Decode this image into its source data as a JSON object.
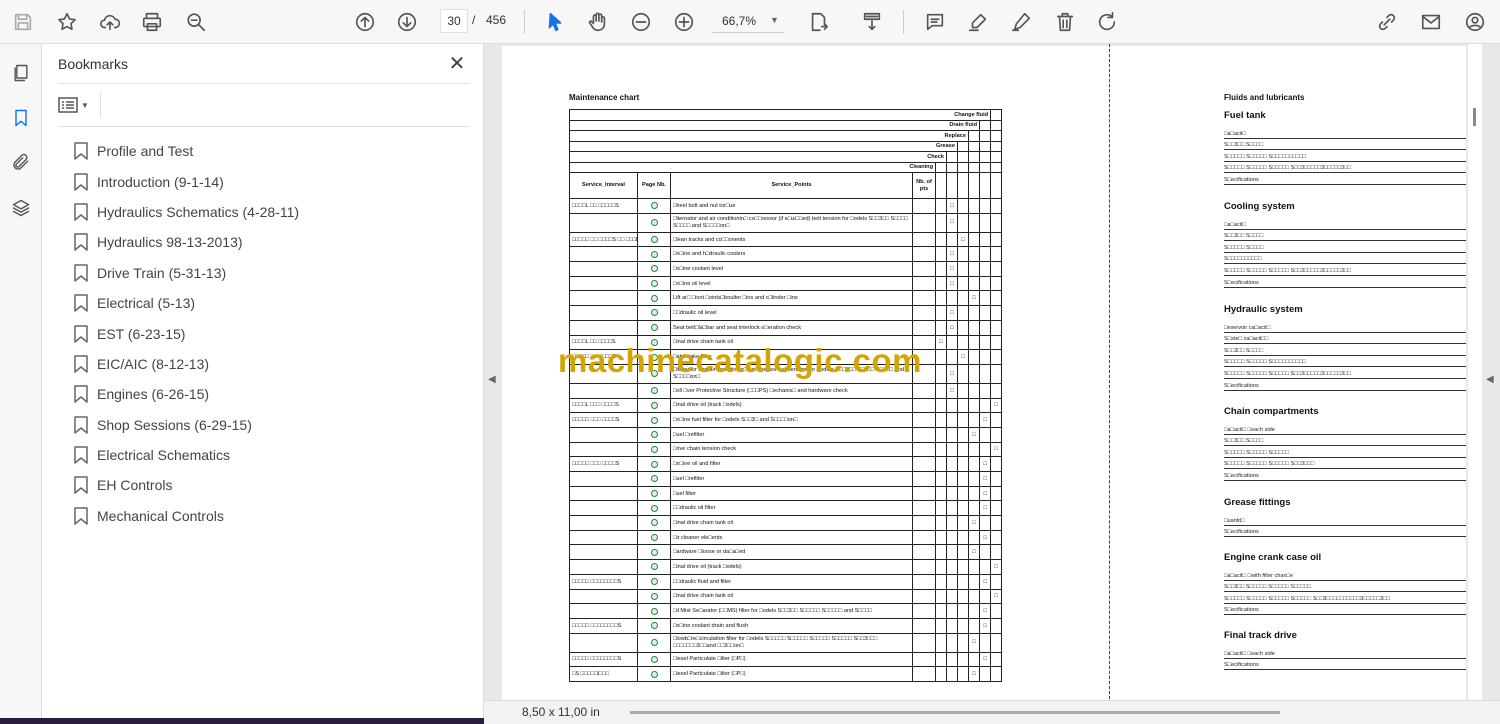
{
  "toolbar": {
    "current_page": "30",
    "page_separator": "/",
    "total_pages": "456",
    "zoom": "66,7%"
  },
  "bookmarks_panel": {
    "title": "Bookmarks",
    "items": [
      "Profile and Test",
      "Introduction (9-1-14)",
      "Hydraulics Schematics (4-28-11)",
      "Hydraulics 98-13-2013)",
      "Drive Train (5-31-13)",
      "Electrical (5-13)",
      "EST (6-23-15)",
      "EIC/AIC (8-12-13)",
      "Engines (6-26-15)",
      "Shop Sessions (6-29-15)",
      "Electrical Schematics",
      "EH Controls",
      "Mechanical Controls"
    ]
  },
  "status": {
    "page_size": "8,50 x 11,00 in"
  },
  "watermark": "machinecatalogic.com",
  "maintenance_chart": {
    "title": "Maintenance chart",
    "header_rows": [
      "Change fluid",
      "Drain fluid",
      "Replace",
      "Grease",
      "Check",
      "Cleaning"
    ],
    "columns": [
      "Service_Interval",
      "Page Nb.",
      "Service_Points",
      "Nb. of pts"
    ],
    "rows": [
      {
        "interval": "□□□□L □□ □□□□□S",
        "point": "□heel bolt and nut tor□ue",
        "tall": false
      },
      {
        "interval": "",
        "point": "□lternator and air conditionin□ co□□ressor (if e□ui□□ed) belt tension for □odels S□□3□□ S□□□□ S□□□□ and S□□□□on□",
        "tall": true
      },
      {
        "interval": "□□□□□ □□ □□□□S □□ □□□L□",
        "point": "□lean tracks and co□□onents",
        "tall": false
      },
      {
        "interval": "",
        "point": "□n□ine and h□draulic coolers",
        "tall": false
      },
      {
        "interval": "",
        "point": "□n□ine coolant level",
        "tall": false
      },
      {
        "interval": "",
        "point": "□n□ine oil level",
        "tall": false
      },
      {
        "interval": "",
        "point": "Lift ar□ □ivot □oints□boulter □ins and c□linder □ins",
        "tall": false
      },
      {
        "interval": "",
        "point": "□□draulic oil level",
        "tall": false
      },
      {
        "interval": "",
        "point": "Seat belt□la□bar and seat interlock o□eration check",
        "tall": false
      },
      {
        "interval": "□□□□L □□ □□□□S",
        "point": "□inal drive chain tank oil",
        "tall": false
      },
      {
        "interval": "□□□□□ □□ □□□□S",
        "point": "□ab intake filter",
        "tall": false
      },
      {
        "interval": "",
        "point": "□lternator and air conditionin□ co□□ressor belt tension for □odels S□□3□□ S□□□□ S□□□□ and S□□□□on□",
        "tall": true
      },
      {
        "interval": "",
        "point": "□oll □ver Protective Structure (□□□PS) □echanis□ and hardware check",
        "tall": false
      },
      {
        "interval": "□□□□L □□□ □□□□S",
        "point": "□inal drive oil (track □odels)",
        "tall": false
      },
      {
        "interval": "□□□□□ □□□ □□□□S",
        "point": "□n□ine fuel filter for □odels S□□3□ and S□□□□on□",
        "tall": false
      },
      {
        "interval": "",
        "point": "□uel □refilter",
        "tall": false
      },
      {
        "interval": "",
        "point": "□rive chain tension check",
        "tall": false
      },
      {
        "interval": "□□□□□ □□□ □□□□S",
        "point": "□n□ine oil and filter",
        "tall": false
      },
      {
        "interval": "",
        "point": "□uel □refilter",
        "tall": false
      },
      {
        "interval": "",
        "point": "□uel filter",
        "tall": false
      },
      {
        "interval": "",
        "point": "□□draulic oil filter",
        "tall": false
      },
      {
        "interval": "",
        "point": "□inal drive chain tank oil",
        "tall": false
      },
      {
        "interval": "",
        "point": "□ir cleaner ele□ents",
        "tall": false
      },
      {
        "interval": "",
        "point": "□ardware □loose or da□a□ed",
        "tall": false
      },
      {
        "interval": "",
        "point": "□inal drive oil (track □odels)",
        "tall": false
      },
      {
        "interval": "□□□□□ □□□□□□□□S",
        "point": "□□draulic fluid and filter",
        "tall": false
      },
      {
        "interval": "",
        "point": "□inal drive chain tank oil",
        "tall": false
      },
      {
        "interval": "",
        "point": "□il Mist Se□arator (□□MS) filter for □odels S□□3□□ S□□□□□ S□□□□□ and S□□□□",
        "tall": false
      },
      {
        "interval": "□□□□□ □□□□□□□□S",
        "point": "□n□ine coolant drain and flush",
        "tall": false
      },
      {
        "interval": "",
        "point": "□lowb□re□circulation filter for □odels S□□□□□ S□□□□□ S□□□□□ S□□□□□ S□□3□□□ □□□□□□□3□□and □□3□□on□",
        "tall": true
      },
      {
        "interval": "□□□□□ □□□□□□□□S",
        "point": "□iesel Particulate □ilter (□P□)",
        "tall": false
      },
      {
        "interval": "□S □□□□□l□□□",
        "point": "□iesel Particulate □ilter (□P□)",
        "tall": false
      }
    ],
    "mark": "□"
  },
  "fluids": {
    "title": "Fluids and lubricants",
    "sections": [
      {
        "name": "Fuel tank",
        "lines": [
          "□a□acit□",
          "S□□3□□ S□□□□",
          "S□□□□□ S□□□□□ S□□□□□□□□□□",
          "S□□□□□ S□□□□□ S□□□□□ S□□3□□□□□3□□□□□3□□",
          "S□ecifications"
        ]
      },
      {
        "name": "Cooling system",
        "lines": [
          "□a□acit□",
          "S□□3□□ S□□□□",
          "S□□□□□ S□□□□",
          "S□□□□□□□□□□",
          "S□□□□□ S□□□□□ S□□□□□ S□□3□□□□□3□□□□□3□□",
          "S□ecifications"
        ]
      },
      {
        "name": "Hydraulic system",
        "lines": [
          "□eservoir ca□acit□",
          "S□ste□ ca□acit□□",
          "S□□3□□ S□□□□",
          "S□□□□□ S□□□□□ S□□□□□□□□□□",
          "S□□□□□ S□□□□□ S□□□□□ S□□3□□□□□3□□□□□3□□",
          "S□ecifications"
        ]
      },
      {
        "name": "Chain compartments",
        "lines": [
          "□a□acit□ □each side",
          "S□□3□□ S□□□□",
          "S□□□□□ S□□□□□ S□□□□□",
          "S□□□□□ S□□□□□ S□□□□□ S□□3□□□",
          "S□ecifications"
        ]
      },
      {
        "name": "Grease fittings",
        "lines": [
          "□uantit□",
          "S□ecifications"
        ]
      },
      {
        "name": "Engine crank case oil",
        "lines": [
          "□a□acit□ □with filter chan□e",
          "S□□3□□ S□□□□□ S□□□□□ S□□□□□",
          "S□□□□□ S□□□□□ S□□□□□ S□□□□□ S□□3□□□□□□□□□□3□□□□□3□□",
          "S□ecifications"
        ]
      },
      {
        "name": "Final track drive",
        "lines": [
          "□a□acit□ □each side",
          "S□ecifications"
        ]
      }
    ]
  },
  "colors": {
    "accent": "#1473e6",
    "watermark": "#d4a400"
  }
}
